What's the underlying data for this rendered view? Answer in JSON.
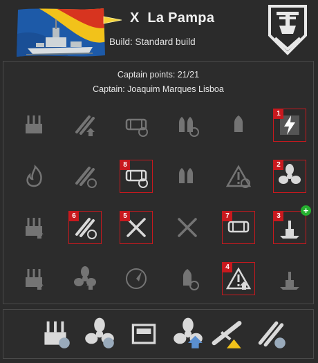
{
  "header": {
    "tier": "X",
    "ship_name": "La Pampa",
    "build": "Build: Standard build",
    "class_icon": "destroyer-class-emblem"
  },
  "captain": {
    "points": "Captain points: 21/21",
    "name": "Captain: Joaquim Marques Lisboa"
  },
  "skills": [
    {
      "icon": "grease-the-gears-icon",
      "selected": false,
      "order": ""
    },
    {
      "icon": "consumable-specialist-icon",
      "selected": false,
      "order": ""
    },
    {
      "icon": "fill-the-tubes-icon",
      "selected": false,
      "order": ""
    },
    {
      "icon": "main-battery-reload-icon",
      "selected": false,
      "order": ""
    },
    {
      "icon": "gun-feeder-icon",
      "selected": false,
      "order": ""
    },
    {
      "icon": "last-stand-icon",
      "selected": true,
      "order": "1"
    },
    {
      "icon": "demolition-expert-icon",
      "selected": false,
      "order": ""
    },
    {
      "icon": "consumable-enthusiast-icon",
      "selected": false,
      "order": ""
    },
    {
      "icon": "swift-fish-icon",
      "selected": true,
      "order": "8"
    },
    {
      "icon": "extra-heavy-ammo-icon",
      "selected": false,
      "order": ""
    },
    {
      "icon": "priority-target-icon",
      "selected": false,
      "order": ""
    },
    {
      "icon": "survivability-expert-icon",
      "selected": true,
      "order": "2"
    },
    {
      "icon": "main-battery-upgrade-icon",
      "selected": false,
      "order": ""
    },
    {
      "icon": "torpedo-armament-expertise-icon",
      "selected": true,
      "order": "6"
    },
    {
      "icon": "swift-in-silence-icon",
      "selected": true,
      "order": "5"
    },
    {
      "icon": "dead-eye-icon",
      "selected": false,
      "order": ""
    },
    {
      "icon": "torpedo-tubes-upgrade-icon",
      "selected": true,
      "order": "7"
    },
    {
      "icon": "concealment-expert-icon",
      "selected": true,
      "order": "3",
      "plus": true
    },
    {
      "icon": "secondary-upgrade-icon",
      "selected": false,
      "order": ""
    },
    {
      "icon": "propulsion-upgrade-icon",
      "selected": false,
      "order": ""
    },
    {
      "icon": "radio-location-icon",
      "selected": false,
      "order": ""
    },
    {
      "icon": "fearless-brawler-icon",
      "selected": false,
      "order": ""
    },
    {
      "icon": "incoming-fire-alert-icon",
      "selected": true,
      "order": "4"
    },
    {
      "icon": "super-intendent-icon",
      "selected": false,
      "order": ""
    }
  ],
  "upgrades": [
    {
      "icon": "main-armaments-modification-icon"
    },
    {
      "icon": "propulsion-modification-icon"
    },
    {
      "icon": "engine-room-protection-icon"
    },
    {
      "icon": "propulsion-modification-2-icon"
    },
    {
      "icon": "aircraft-detection-icon"
    },
    {
      "icon": "torpedo-reload-modification-icon"
    }
  ]
}
